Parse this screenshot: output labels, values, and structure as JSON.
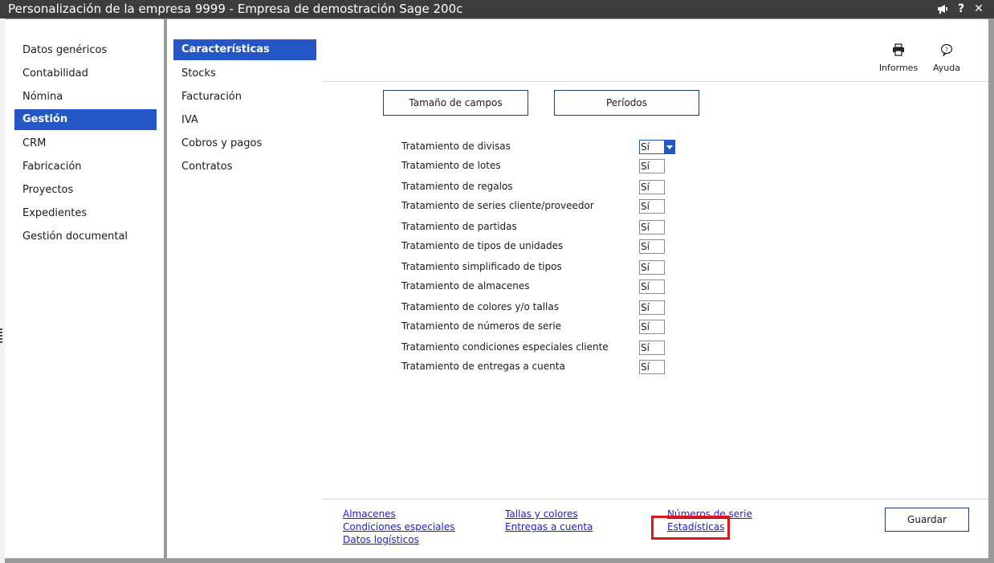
{
  "window": {
    "title": "Personalización de la empresa  9999 - Empresa de demostración Sage 200c",
    "buttons": [
      "megaphone-icon",
      "help-icon",
      "close-icon"
    ]
  },
  "nav_primary": {
    "items": [
      {
        "label": "Datos genéricos",
        "active": false
      },
      {
        "label": "Contabilidad",
        "active": false
      },
      {
        "label": "Nómina",
        "active": false
      },
      {
        "label": "Gestión",
        "active": true
      },
      {
        "label": "CRM",
        "active": false
      },
      {
        "label": "Fabricación",
        "active": false
      },
      {
        "label": "Proyectos",
        "active": false
      },
      {
        "label": "Expedientes",
        "active": false
      },
      {
        "label": "Gestión documental",
        "active": false
      }
    ]
  },
  "nav_secondary": {
    "items": [
      {
        "label": "Características",
        "active": true
      },
      {
        "label": "Stocks",
        "active": false
      },
      {
        "label": "Facturación",
        "active": false
      },
      {
        "label": "IVA",
        "active": false
      },
      {
        "label": "Cobros y pagos",
        "active": false
      },
      {
        "label": "Contratos",
        "active": false
      }
    ]
  },
  "toolbar": {
    "informes_label": "Informes",
    "ayuda_label": "Ayuda"
  },
  "actions": {
    "tamano_label": "Tamaño de campos",
    "periodos_label": "Períodos"
  },
  "settings": [
    {
      "label": "Tratamiento de divisas",
      "value": "Sí"
    },
    {
      "label": "Tratamiento de lotes",
      "value": "Sí"
    },
    {
      "label": "Tratamiento de regalos",
      "value": "Sí"
    },
    {
      "label": "Tratamiento de series cliente/proveedor",
      "value": "Sí"
    },
    {
      "label": "Tratamiento de partidas",
      "value": "Sí"
    },
    {
      "label": "Tratamiento de tipos de unidades",
      "value": "Sí"
    },
    {
      "label": "Tratamiento simplificado de tipos",
      "value": "Sí"
    },
    {
      "label": "Tratamiento de almacenes",
      "value": "Sí"
    },
    {
      "label": "Tratamiento de colores y/o tallas",
      "value": "Sí"
    },
    {
      "label": "Tratamiento de números de serie",
      "value": "Sí"
    },
    {
      "label": "Tratamiento condiciones especiales cliente",
      "value": "Sí"
    },
    {
      "label": "Tratamiento de entregas a cuenta",
      "value": "Sí"
    }
  ],
  "links": {
    "almacenes": "Almacenes",
    "condiciones": "Condiciones especiales",
    "datos_logisticos": "Datos logísticos",
    "tallas": "Tallas y colores",
    "entregas": "Entregas a cuenta",
    "numeros_serie": "Números de serie",
    "estadisticas": "Estadísticas"
  },
  "footer": {
    "guardar_label": "Guardar"
  },
  "colors": {
    "accent": "#2457c5",
    "titlebar": "#3d3d3d",
    "highlight": "#e0161b"
  }
}
